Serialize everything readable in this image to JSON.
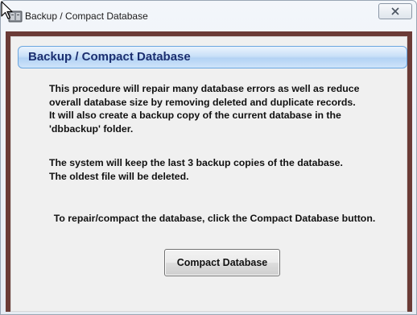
{
  "window": {
    "title": "Backup / Compact Database"
  },
  "panel": {
    "header": "Backup / Compact Database",
    "paragraph1": [
      "This procedure will repair many database errors as well as reduce",
      "overall database size by removing deleted and duplicate records.",
      "It will also create a backup copy of the current database in the",
      "'dbbackup' folder."
    ],
    "paragraph2": [
      "The system will keep the last 3 backup copies of the database.",
      "The oldest file will be deleted."
    ],
    "instruction": "To repair/compact the database, click the Compact Database button.",
    "button_label": "Compact Database"
  },
  "icons": {
    "title_icon": "database-icon",
    "close": "close-icon",
    "cursor": "mouse-cursor-icon"
  },
  "colors": {
    "frame": "#6b3b36",
    "header_text": "#1c2f70",
    "header_border": "#6aa6e0"
  }
}
